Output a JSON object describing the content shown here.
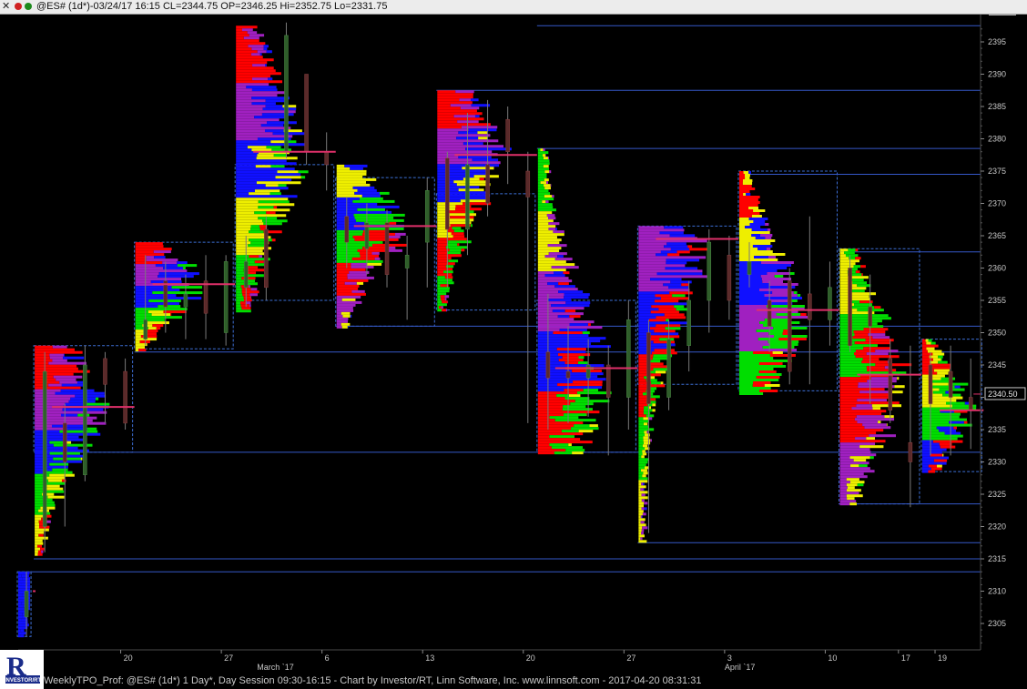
{
  "window": {
    "close_glyph": "✕",
    "title": "@ES# (1d*)-03/24/17 16:15 CL=2344.75 OP=2346.25 Hi=2352.75 Lo=2331.75",
    "footer": "WeeklyTPO_Prof: @ES# (1d*) 1 Day*, Day Session 09:30-16:15 - Chart by Investor/RT, Linn Software, Inc. www.linnsoft.com - 2017-04-20 08:31:31",
    "logo_letter": "R",
    "logo_text": "INVESTOR/RT"
  },
  "colors": {
    "background": "#000000",
    "axis": "#4a4a4a",
    "text": "#c8c8c8",
    "value_area_box": "#3d6fd6",
    "level_line": "#3558c8",
    "poc_line": "#e0306a",
    "candle_up": "#2f5e2a",
    "candle_down": "#5a2a2a",
    "wick": "#7a7a7a",
    "tpo_red": "#ff0000",
    "tpo_magenta": "#a020c0",
    "tpo_blue": "#1010ff",
    "tpo_green": "#00dd00",
    "tpo_yellow": "#eeee00"
  },
  "chart_data": {
    "type": "market-profile",
    "title": "",
    "symbol": "@ES#",
    "ylim": [
      2301,
      2398
    ],
    "y_ticks": [
      2305,
      2310,
      2315,
      2320,
      2325,
      2330,
      2335,
      2340,
      2345,
      2350,
      2355,
      2360,
      2365,
      2370,
      2375,
      2380,
      2385,
      2390,
      2395
    ],
    "x_ticks": [
      {
        "label": "20",
        "slot": 11.3
      },
      {
        "label": "27",
        "slot": 22.3
      },
      {
        "label": "6",
        "slot": 33.3
      },
      {
        "label": "13",
        "slot": 44.3
      },
      {
        "label": "20",
        "slot": 55.3
      },
      {
        "label": "27",
        "slot": 66.3
      },
      {
        "label": "3",
        "slot": 77.3
      },
      {
        "label": "10",
        "slot": 88.3
      },
      {
        "label": "17",
        "slot": 96.3
      },
      {
        "label": "19",
        "slot": 100.3
      }
    ],
    "month_labels": [
      {
        "label": "March `17",
        "slot": 26.2
      },
      {
        "label": "April `17",
        "slot": 77.3
      }
    ],
    "last_price": 2340.5,
    "last_price_label": "2340.50",
    "weeks": [
      {
        "start": 0,
        "end": 1.5,
        "high": 2313,
        "low": 2303,
        "vah": 2313,
        "val": 2303,
        "poc": 2310,
        "colors": [
          "blue"
        ]
      },
      {
        "start": 1.8,
        "end": 12.6,
        "high": 2348,
        "low": 2315.5,
        "vah": 2348,
        "val": 2331.5,
        "poc": 2338.5,
        "colors": [
          "red",
          "magenta",
          "blue",
          "green",
          "yellow"
        ]
      },
      {
        "start": 12.8,
        "end": 23.6,
        "high": 2364,
        "low": 2347.5,
        "vah": 2364,
        "val": 2347.5,
        "poc": 2357.5,
        "colors": [
          "red",
          "magenta",
          "blue",
          "green",
          "yellow"
        ]
      },
      {
        "start": 23.8,
        "end": 34.6,
        "high": 2397.5,
        "low": 2353.5,
        "vah": 2376,
        "val": 2355,
        "poc": 2378,
        "colors": [
          "red",
          "magenta",
          "blue",
          "yellow",
          "green"
        ]
      },
      {
        "start": 34.8,
        "end": 45.6,
        "high": 2376,
        "low": 2351,
        "vah": 2374,
        "val": 2351,
        "poc": 2366.5,
        "colors": [
          "yellow",
          "blue",
          "green",
          "red",
          "magenta"
        ]
      },
      {
        "start": 45.8,
        "end": 56.6,
        "high": 2387.5,
        "low": 2353.5,
        "vah": 2371.5,
        "val": 2353.5,
        "poc": 2377.5,
        "colors": [
          "red",
          "magenta",
          "blue",
          "yellow",
          "red",
          "green"
        ]
      },
      {
        "start": 56.8,
        "end": 67.6,
        "high": 2378.5,
        "low": 2331.5,
        "vah": 2355,
        "val": 2331.5,
        "poc": 2344.5,
        "colors": [
          "green",
          "yellow",
          "magenta",
          "blue",
          "red"
        ]
      },
      {
        "start": 67.8,
        "end": 78.6,
        "high": 2366.5,
        "low": 2317.5,
        "vah": 2366.5,
        "val": 2342,
        "poc": 2364.5,
        "colors": [
          "magenta",
          "blue",
          "red",
          "green",
          "yellow"
        ]
      },
      {
        "start": 78.8,
        "end": 89.6,
        "high": 2375,
        "low": 2340.5,
        "vah": 2375,
        "val": 2341,
        "poc": 2353.5,
        "colors": [
          "red",
          "yellow",
          "blue",
          "magenta",
          "green"
        ]
      },
      {
        "start": 89.8,
        "end": 98.6,
        "high": 2363,
        "low": 2323.5,
        "vah": 2363,
        "val": 2323.5,
        "poc": 2343.5,
        "colors": [
          "yellow",
          "green",
          "red",
          "magenta"
        ]
      },
      {
        "start": 98.8,
        "end": 105.4,
        "high": 2349,
        "low": 2328.5,
        "vah": 2349,
        "val": 2328.5,
        "poc": 2338,
        "colors": [
          "red",
          "yellow",
          "green",
          "blue"
        ]
      }
    ],
    "levels": [
      2397.5,
      2387.5,
      2378.5,
      2374.5,
      2362.5,
      2351,
      2347,
      2331.5,
      2323.5,
      2317.5,
      2315,
      2313
    ],
    "candles": [
      {
        "slot": 1.0,
        "o": 2306,
        "c": 2310,
        "h": 2313,
        "l": 2303
      },
      {
        "slot": 3.0,
        "o": 2320,
        "c": 2344,
        "h": 2347,
        "l": 2316
      },
      {
        "slot": 5.2,
        "o": 2336,
        "c": 2330,
        "h": 2339,
        "l": 2320
      },
      {
        "slot": 7.4,
        "o": 2328,
        "c": 2345,
        "h": 2348,
        "l": 2327
      },
      {
        "slot": 9.6,
        "o": 2346,
        "c": 2342,
        "h": 2347,
        "l": 2336
      },
      {
        "slot": 11.8,
        "o": 2344,
        "c": 2336,
        "h": 2346,
        "l": 2335
      },
      {
        "slot": 14.0,
        "o": 2349,
        "c": 2352,
        "h": 2362,
        "l": 2348
      },
      {
        "slot": 16.2,
        "o": 2358,
        "c": 2354,
        "h": 2361,
        "l": 2350
      },
      {
        "slot": 18.4,
        "o": 2354,
        "c": 2356,
        "h": 2359,
        "l": 2349
      },
      {
        "slot": 20.6,
        "o": 2358,
        "c": 2353,
        "h": 2362,
        "l": 2349
      },
      {
        "slot": 22.8,
        "o": 2350,
        "c": 2361,
        "h": 2362,
        "l": 2348
      },
      {
        "slot": 25.0,
        "o": 2357,
        "c": 2361,
        "h": 2365,
        "l": 2354
      },
      {
        "slot": 27.2,
        "o": 2366,
        "c": 2357,
        "h": 2368,
        "l": 2355
      },
      {
        "slot": 29.4,
        "o": 2378,
        "c": 2396,
        "h": 2398,
        "l": 2377
      },
      {
        "slot": 31.6,
        "o": 2390,
        "c": 2378,
        "h": 2390,
        "l": 2376
      },
      {
        "slot": 33.8,
        "o": 2378,
        "c": 2376,
        "h": 2381,
        "l": 2372
      },
      {
        "slot": 36.0,
        "o": 2368,
        "c": 2364,
        "h": 2371,
        "l": 2360
      },
      {
        "slot": 38.2,
        "o": 2363,
        "c": 2367,
        "h": 2370,
        "l": 2359
      },
      {
        "slot": 40.4,
        "o": 2367,
        "c": 2359,
        "h": 2369,
        "l": 2357
      },
      {
        "slot": 42.6,
        "o": 2360,
        "c": 2362,
        "h": 2365,
        "l": 2352
      },
      {
        "slot": 44.8,
        "o": 2364,
        "c": 2372,
        "h": 2374,
        "l": 2357
      },
      {
        "slot": 47.0,
        "o": 2377,
        "c": 2366,
        "h": 2378,
        "l": 2357
      },
      {
        "slot": 49.2,
        "o": 2366,
        "c": 2376,
        "h": 2384,
        "l": 2362
      },
      {
        "slot": 51.4,
        "o": 2376,
        "c": 2370,
        "h": 2386,
        "l": 2368
      },
      {
        "slot": 53.6,
        "o": 2383,
        "c": 2378,
        "h": 2385,
        "l": 2373
      },
      {
        "slot": 55.8,
        "o": 2375,
        "c": 2371,
        "h": 2378,
        "l": 2336
      },
      {
        "slot": 58.0,
        "o": 2347,
        "c": 2343,
        "h": 2356,
        "l": 2335
      },
      {
        "slot": 60.2,
        "o": 2344,
        "c": 2343,
        "h": 2351,
        "l": 2336
      },
      {
        "slot": 62.4,
        "o": 2343,
        "c": 2345,
        "h": 2349,
        "l": 2337
      },
      {
        "slot": 64.6,
        "o": 2345,
        "c": 2340,
        "h": 2348,
        "l": 2331
      },
      {
        "slot": 66.8,
        "o": 2340,
        "c": 2352,
        "h": 2355,
        "l": 2335
      },
      {
        "slot": 69.0,
        "o": 2350,
        "c": 2339,
        "h": 2352,
        "l": 2319
      },
      {
        "slot": 71.2,
        "o": 2340,
        "c": 2349,
        "h": 2352,
        "l": 2338
      },
      {
        "slot": 73.4,
        "o": 2348,
        "c": 2355,
        "h": 2358,
        "l": 2344
      },
      {
        "slot": 75.6,
        "o": 2355,
        "c": 2364,
        "h": 2366,
        "l": 2350
      },
      {
        "slot": 77.8,
        "o": 2362,
        "c": 2355,
        "h": 2365,
        "l": 2352
      },
      {
        "slot": 80.0,
        "o": 2359,
        "c": 2361,
        "h": 2364,
        "l": 2357
      },
      {
        "slot": 82.2,
        "o": 2355,
        "c": 2351,
        "h": 2358,
        "l": 2347
      },
      {
        "slot": 84.4,
        "o": 2358,
        "c": 2344,
        "h": 2360,
        "l": 2342
      },
      {
        "slot": 86.6,
        "o": 2356,
        "c": 2352,
        "h": 2368,
        "l": 2342
      },
      {
        "slot": 88.8,
        "o": 2352,
        "c": 2357,
        "h": 2361,
        "l": 2348
      },
      {
        "slot": 91.0,
        "o": 2360,
        "c": 2348,
        "h": 2362,
        "l": 2347
      },
      {
        "slot": 93.2,
        "o": 2354,
        "c": 2351,
        "h": 2359,
        "l": 2339
      },
      {
        "slot": 95.4,
        "o": 2346,
        "c": 2338,
        "h": 2349,
        "l": 2336
      },
      {
        "slot": 97.6,
        "o": 2333,
        "c": 2330,
        "h": 2348,
        "l": 2323
      },
      {
        "slot": 99.8,
        "o": 2345,
        "c": 2339,
        "h": 2347,
        "l": 2331
      },
      {
        "slot": 102.0,
        "o": 2344,
        "c": 2340,
        "h": 2348,
        "l": 2331
      },
      {
        "slot": 104.2,
        "o": 2340,
        "c": 2338,
        "h": 2346,
        "l": 2332
      }
    ]
  }
}
